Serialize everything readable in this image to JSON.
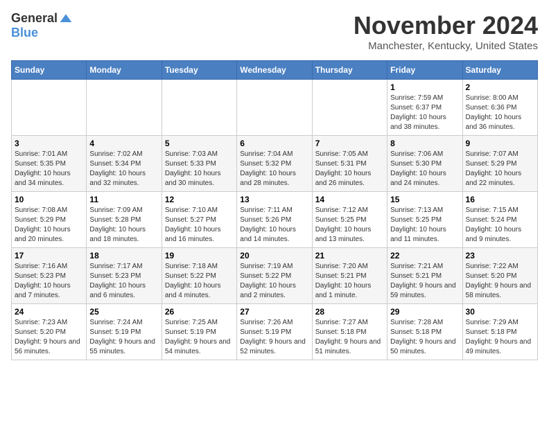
{
  "logo": {
    "general": "General",
    "blue": "Blue"
  },
  "title": {
    "month": "November 2024",
    "location": "Manchester, Kentucky, United States"
  },
  "days_of_week": [
    "Sunday",
    "Monday",
    "Tuesday",
    "Wednesday",
    "Thursday",
    "Friday",
    "Saturday"
  ],
  "weeks": [
    [
      {
        "day": "",
        "info": ""
      },
      {
        "day": "",
        "info": ""
      },
      {
        "day": "",
        "info": ""
      },
      {
        "day": "",
        "info": ""
      },
      {
        "day": "",
        "info": ""
      },
      {
        "day": "1",
        "info": "Sunrise: 7:59 AM\nSunset: 6:37 PM\nDaylight: 10 hours and 38 minutes."
      },
      {
        "day": "2",
        "info": "Sunrise: 8:00 AM\nSunset: 6:36 PM\nDaylight: 10 hours and 36 minutes."
      }
    ],
    [
      {
        "day": "3",
        "info": "Sunrise: 7:01 AM\nSunset: 5:35 PM\nDaylight: 10 hours and 34 minutes."
      },
      {
        "day": "4",
        "info": "Sunrise: 7:02 AM\nSunset: 5:34 PM\nDaylight: 10 hours and 32 minutes."
      },
      {
        "day": "5",
        "info": "Sunrise: 7:03 AM\nSunset: 5:33 PM\nDaylight: 10 hours and 30 minutes."
      },
      {
        "day": "6",
        "info": "Sunrise: 7:04 AM\nSunset: 5:32 PM\nDaylight: 10 hours and 28 minutes."
      },
      {
        "day": "7",
        "info": "Sunrise: 7:05 AM\nSunset: 5:31 PM\nDaylight: 10 hours and 26 minutes."
      },
      {
        "day": "8",
        "info": "Sunrise: 7:06 AM\nSunset: 5:30 PM\nDaylight: 10 hours and 24 minutes."
      },
      {
        "day": "9",
        "info": "Sunrise: 7:07 AM\nSunset: 5:29 PM\nDaylight: 10 hours and 22 minutes."
      }
    ],
    [
      {
        "day": "10",
        "info": "Sunrise: 7:08 AM\nSunset: 5:29 PM\nDaylight: 10 hours and 20 minutes."
      },
      {
        "day": "11",
        "info": "Sunrise: 7:09 AM\nSunset: 5:28 PM\nDaylight: 10 hours and 18 minutes."
      },
      {
        "day": "12",
        "info": "Sunrise: 7:10 AM\nSunset: 5:27 PM\nDaylight: 10 hours and 16 minutes."
      },
      {
        "day": "13",
        "info": "Sunrise: 7:11 AM\nSunset: 5:26 PM\nDaylight: 10 hours and 14 minutes."
      },
      {
        "day": "14",
        "info": "Sunrise: 7:12 AM\nSunset: 5:25 PM\nDaylight: 10 hours and 13 minutes."
      },
      {
        "day": "15",
        "info": "Sunrise: 7:13 AM\nSunset: 5:25 PM\nDaylight: 10 hours and 11 minutes."
      },
      {
        "day": "16",
        "info": "Sunrise: 7:15 AM\nSunset: 5:24 PM\nDaylight: 10 hours and 9 minutes."
      }
    ],
    [
      {
        "day": "17",
        "info": "Sunrise: 7:16 AM\nSunset: 5:23 PM\nDaylight: 10 hours and 7 minutes."
      },
      {
        "day": "18",
        "info": "Sunrise: 7:17 AM\nSunset: 5:23 PM\nDaylight: 10 hours and 6 minutes."
      },
      {
        "day": "19",
        "info": "Sunrise: 7:18 AM\nSunset: 5:22 PM\nDaylight: 10 hours and 4 minutes."
      },
      {
        "day": "20",
        "info": "Sunrise: 7:19 AM\nSunset: 5:22 PM\nDaylight: 10 hours and 2 minutes."
      },
      {
        "day": "21",
        "info": "Sunrise: 7:20 AM\nSunset: 5:21 PM\nDaylight: 10 hours and 1 minute."
      },
      {
        "day": "22",
        "info": "Sunrise: 7:21 AM\nSunset: 5:21 PM\nDaylight: 9 hours and 59 minutes."
      },
      {
        "day": "23",
        "info": "Sunrise: 7:22 AM\nSunset: 5:20 PM\nDaylight: 9 hours and 58 minutes."
      }
    ],
    [
      {
        "day": "24",
        "info": "Sunrise: 7:23 AM\nSunset: 5:20 PM\nDaylight: 9 hours and 56 minutes."
      },
      {
        "day": "25",
        "info": "Sunrise: 7:24 AM\nSunset: 5:19 PM\nDaylight: 9 hours and 55 minutes."
      },
      {
        "day": "26",
        "info": "Sunrise: 7:25 AM\nSunset: 5:19 PM\nDaylight: 9 hours and 54 minutes."
      },
      {
        "day": "27",
        "info": "Sunrise: 7:26 AM\nSunset: 5:19 PM\nDaylight: 9 hours and 52 minutes."
      },
      {
        "day": "28",
        "info": "Sunrise: 7:27 AM\nSunset: 5:18 PM\nDaylight: 9 hours and 51 minutes."
      },
      {
        "day": "29",
        "info": "Sunrise: 7:28 AM\nSunset: 5:18 PM\nDaylight: 9 hours and 50 minutes."
      },
      {
        "day": "30",
        "info": "Sunrise: 7:29 AM\nSunset: 5:18 PM\nDaylight: 9 hours and 49 minutes."
      }
    ]
  ]
}
